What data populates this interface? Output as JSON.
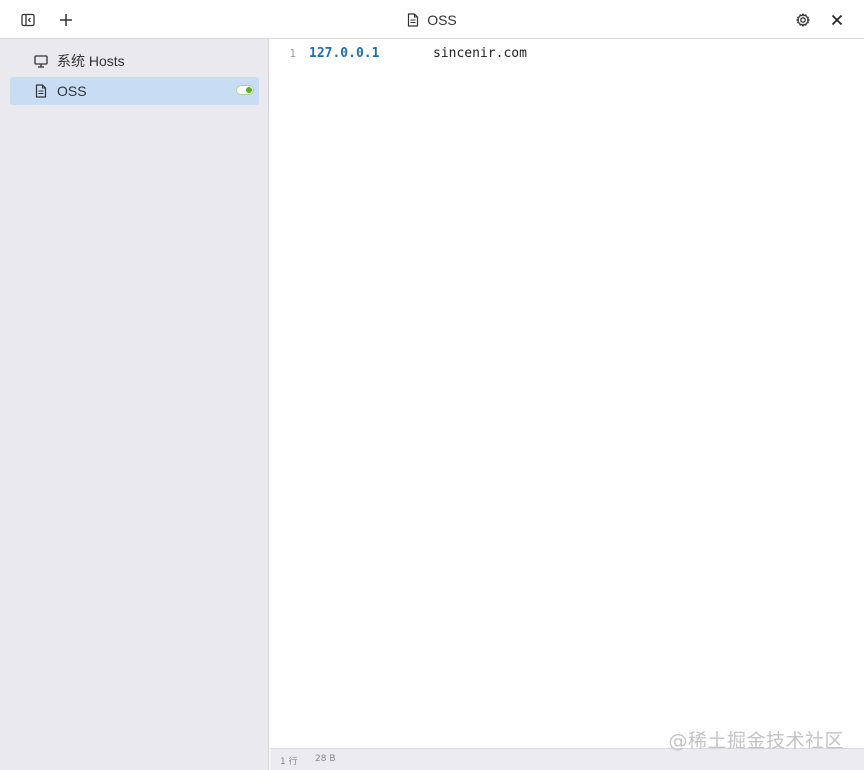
{
  "toolbar": {
    "sidebar_toggle_icon": "sidebar-collapse-icon",
    "add_icon": "plus-icon",
    "title": "OSS",
    "title_icon": "document-icon",
    "settings_icon": "gear-icon",
    "close_icon": "close-icon"
  },
  "sidebar": {
    "items": [
      {
        "label": "系统 Hosts",
        "icon": "monitor-icon",
        "active": false
      },
      {
        "label": "OSS",
        "icon": "document-icon",
        "active": true,
        "enabled": true
      }
    ]
  },
  "editor": {
    "lines": [
      {
        "number": "1",
        "ip": "127.0.0.1",
        "host": "sincenir.com"
      }
    ]
  },
  "status": {
    "line_count": "1 行",
    "size": "28 B"
  },
  "watermark": "@稀土掘金技术社区",
  "colors": {
    "sidebar_bg": "#eaeaee",
    "active_item_bg": "#c8dcf4",
    "ip_color": "#1f6fb2",
    "toggle_on": "#56b02b"
  }
}
